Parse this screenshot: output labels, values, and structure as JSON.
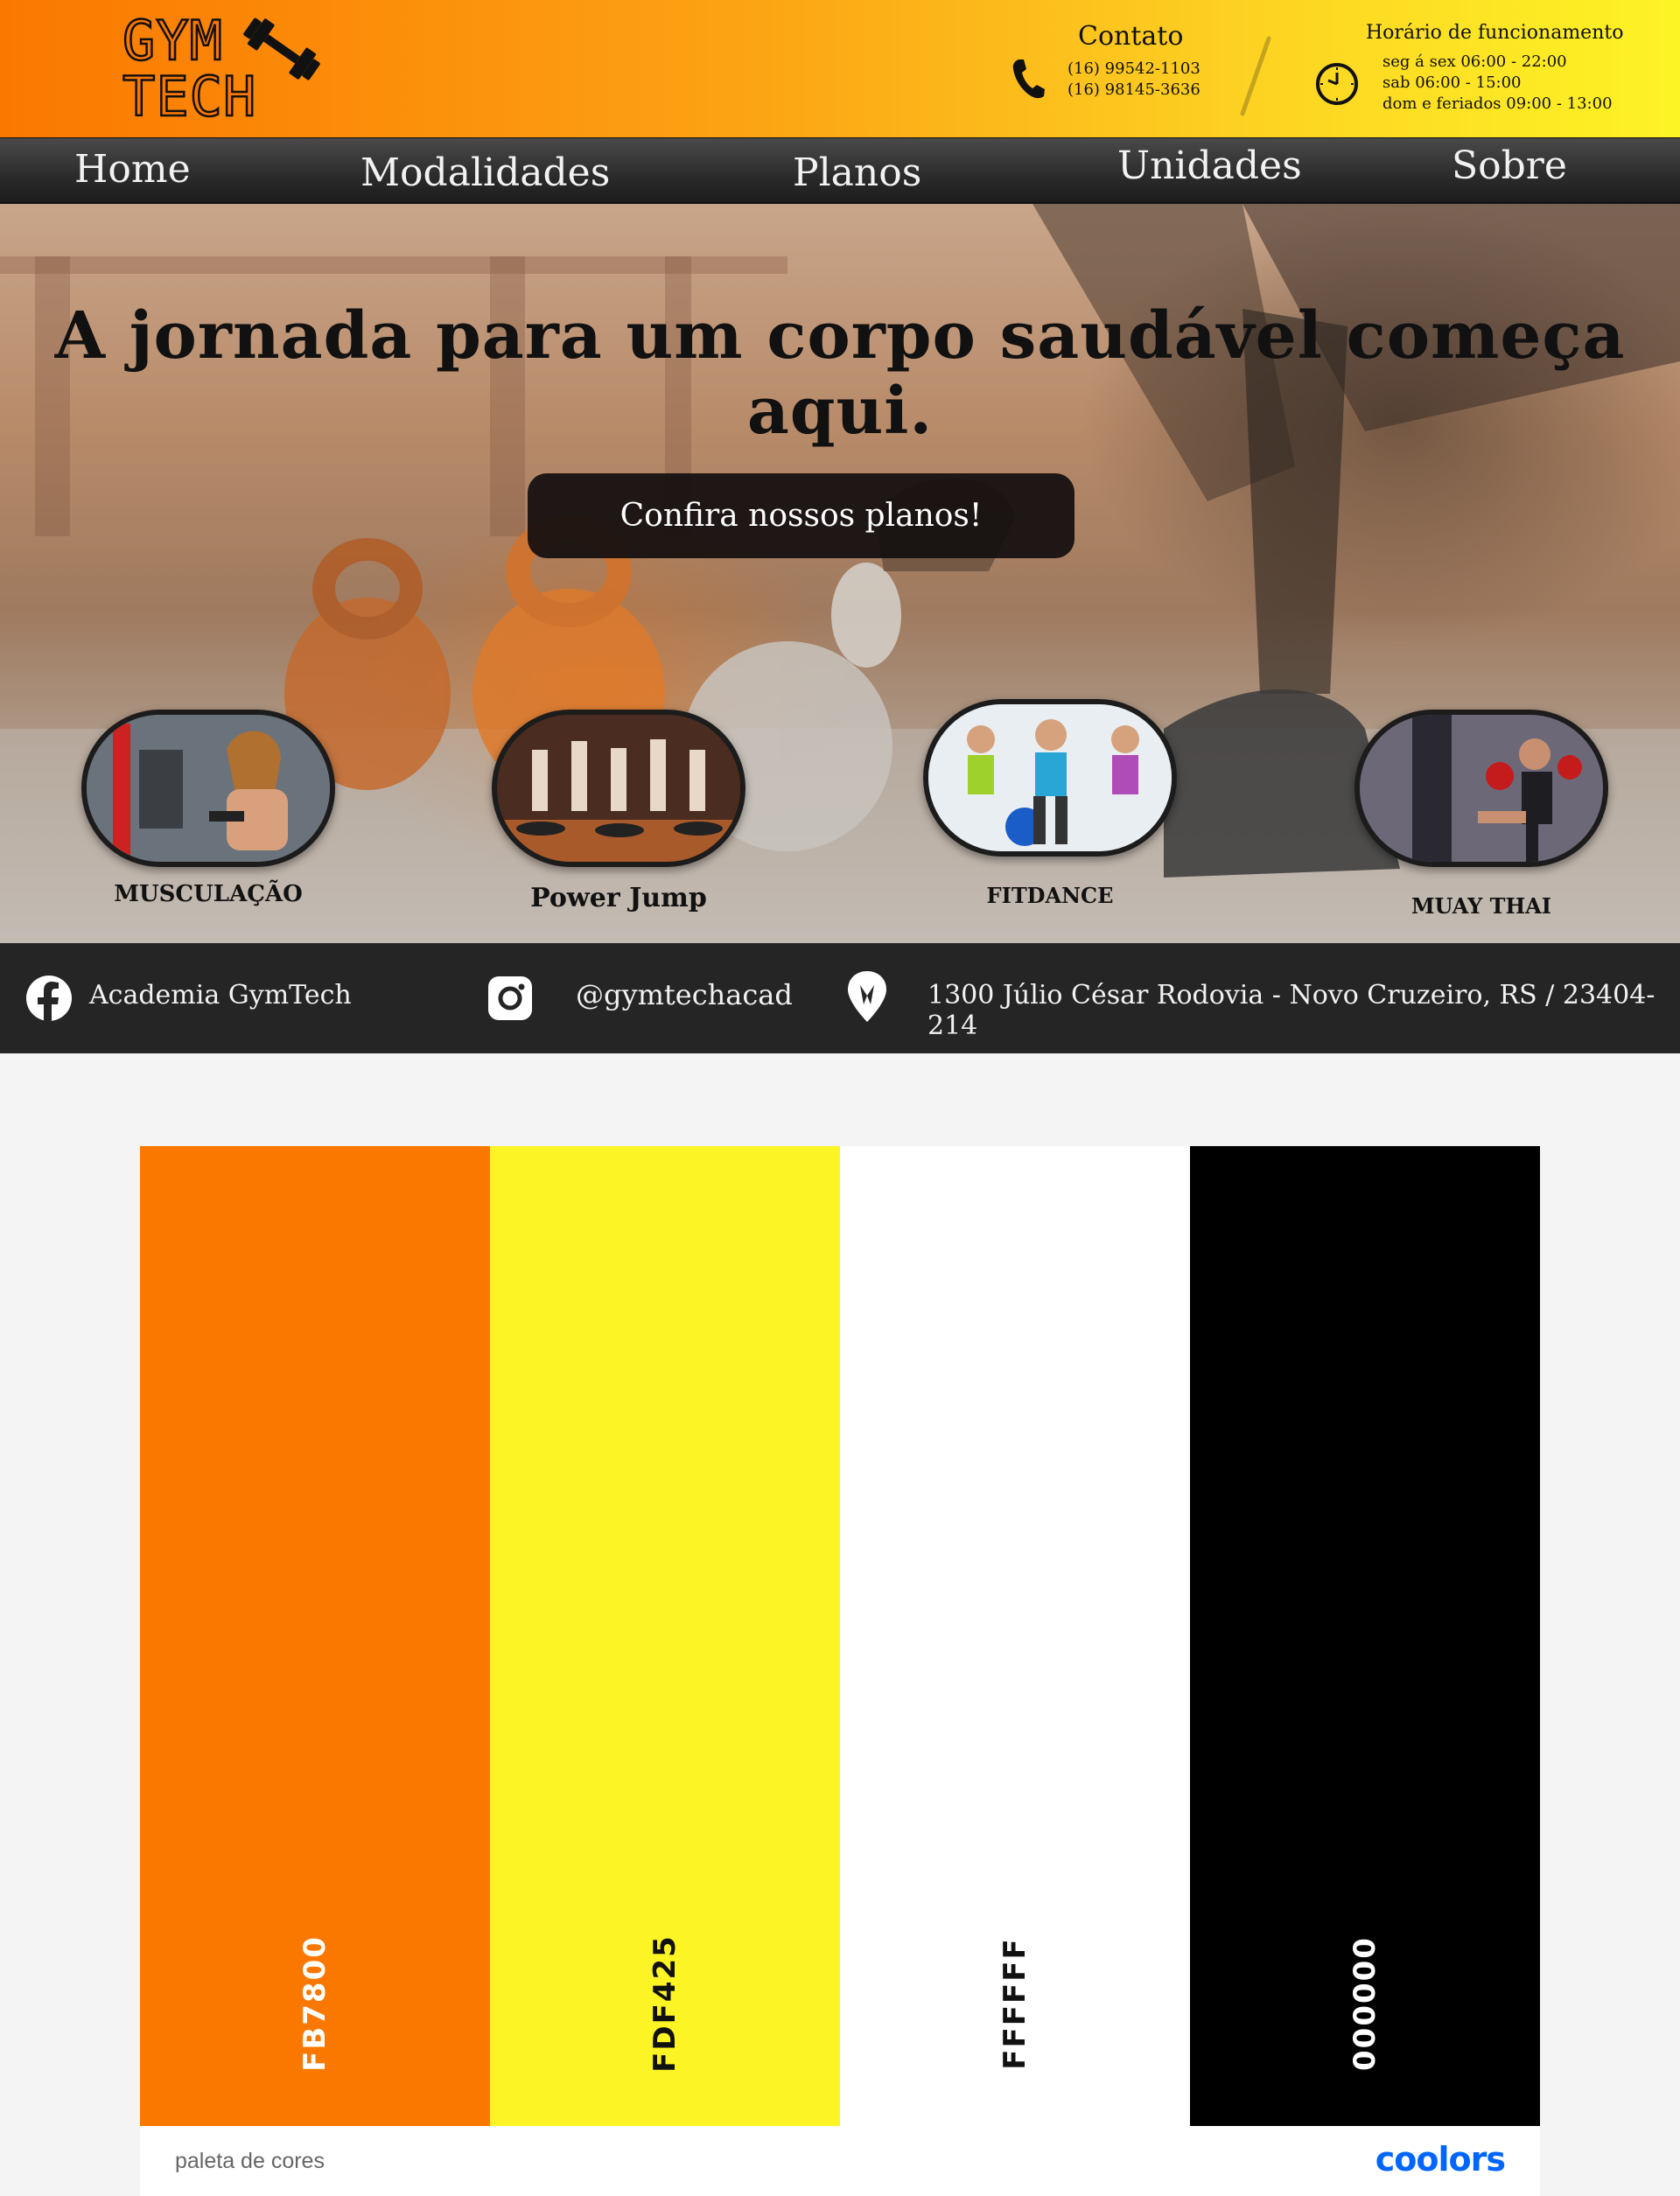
{
  "header": {
    "logo_line1": "GYM",
    "logo_line2": "TECH",
    "contact_title": "Contato",
    "phones": [
      "(16) 99542-1103",
      "(16) 98145-3636"
    ],
    "hours_title": "Horário de funcionamento",
    "hours": [
      "seg á sex 06:00 - 22:00",
      "sab 06:00 - 15:00",
      "dom e feriados 09:00 - 13:00"
    ]
  },
  "nav": {
    "items": [
      {
        "label": "Home"
      },
      {
        "label": "Modalidades"
      },
      {
        "label": "Planos"
      },
      {
        "label": "Unidades"
      },
      {
        "label": "Sobre"
      }
    ]
  },
  "hero": {
    "title": "A jornada para um corpo saudável começa aqui.",
    "cta_label": "Confira nossos planos!"
  },
  "modalities": [
    {
      "label": "MUSCULAÇÃO",
      "icon": "musculacao-photo"
    },
    {
      "label": "Power Jump",
      "icon": "power-jump-photo"
    },
    {
      "label": "FITDANCE",
      "icon": "fitdance-photo"
    },
    {
      "label": "MUAY THAI",
      "icon": "muay-thai-photo"
    }
  ],
  "footer": {
    "facebook": "Academia GymTech",
    "instagram": "@gymtechacad",
    "address": "1300 Júlio César Rodovia - Novo Cruzeiro, RS / 23404-214"
  },
  "palette": {
    "swatches": [
      {
        "code": "FB7800",
        "color": "#FB7800",
        "text_color": "#FFFFFF"
      },
      {
        "code": "FDF425",
        "color": "#FDF425",
        "text_color": "#111111"
      },
      {
        "code": "FFFFFF",
        "color": "#FFFFFF",
        "text_color": "#111111"
      },
      {
        "code": "000000",
        "color": "#000000",
        "text_color": "#FFFFFF"
      }
    ],
    "name": "paleta de cores",
    "brand": "coolors"
  }
}
